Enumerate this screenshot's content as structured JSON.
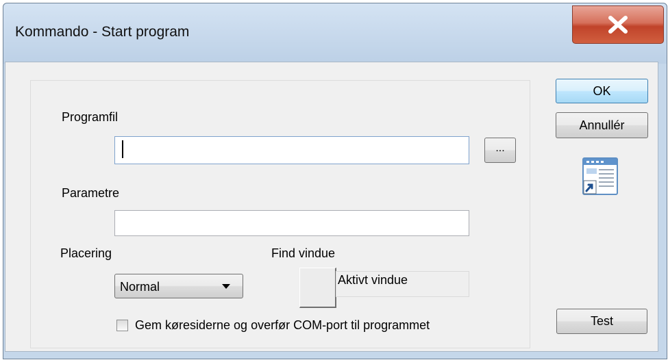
{
  "window": {
    "title": "Kommando - Start program",
    "close_icon": "close-x-icon",
    "close_color": "#c7452d"
  },
  "form": {
    "program_label": "Programfil",
    "program_value": "",
    "browse_label": "...",
    "params_label": "Parametre",
    "params_value": "",
    "placement_label": "Placering",
    "placement_value": "Normal",
    "find_window_label": "Find vindue",
    "active_window_text": "Aktivt vindue",
    "save_pages_label": "Gem køresiderne og overfør COM-port til programmet",
    "save_pages_checked": false
  },
  "buttons": {
    "ok": "OK",
    "cancel": "Annullér",
    "test": "Test"
  },
  "icons": {
    "command_icon": "start-program-shortcut-icon",
    "dropdown_icon": "chevron-down-icon",
    "finder_tool": "window-finder-icon"
  },
  "colors": {
    "accent_button": "#3c7fb1",
    "title_bar": "#c5d7ea"
  }
}
